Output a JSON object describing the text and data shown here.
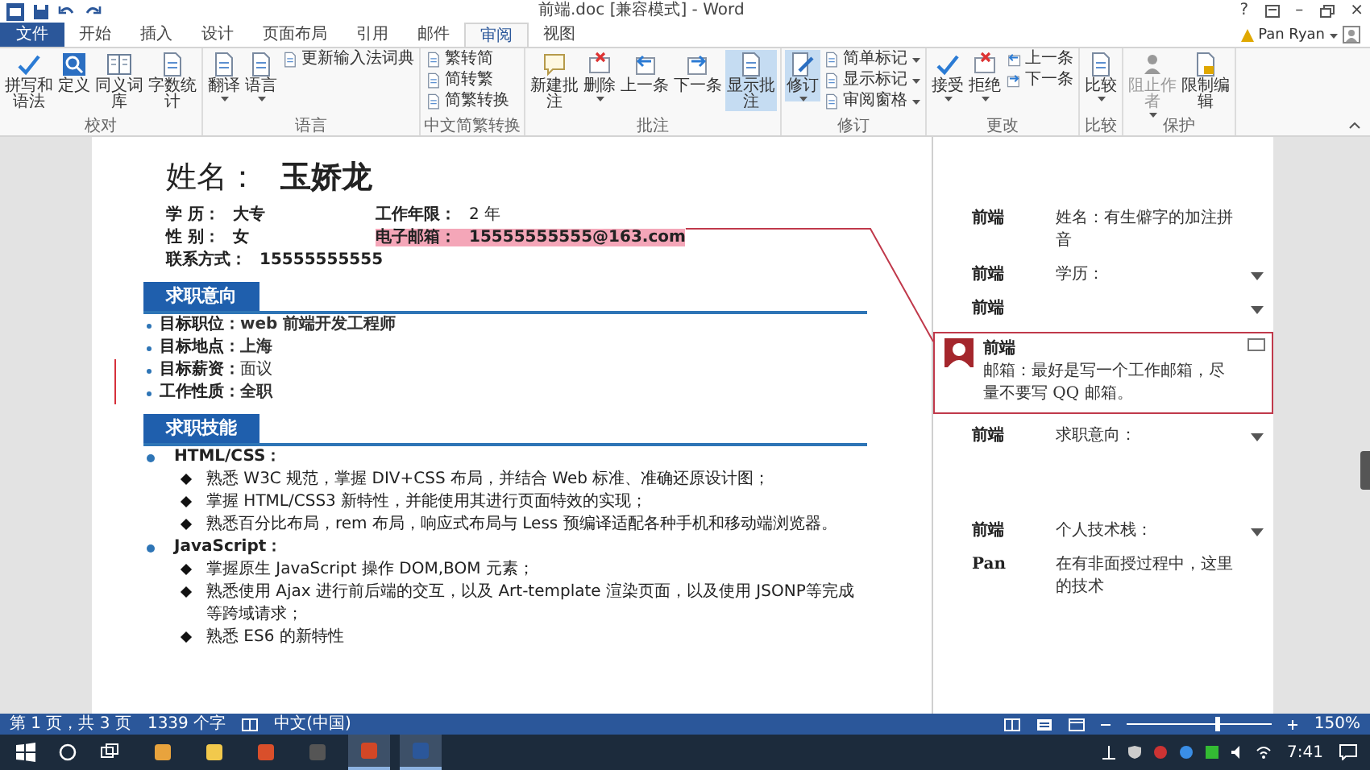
{
  "window": {
    "title": "前端.doc [兼容模式] - Word",
    "help": "?",
    "minimize": "–",
    "close": "×",
    "user": "Pan Ryan"
  },
  "tabs": [
    {
      "label": "文件",
      "kind": "file",
      "selected": false
    },
    {
      "label": "开始",
      "kind": "tab",
      "selected": false
    },
    {
      "label": "插入",
      "kind": "tab",
      "selected": false
    },
    {
      "label": "设计",
      "kind": "tab",
      "selected": false
    },
    {
      "label": "页面布局",
      "kind": "tab",
      "selected": false
    },
    {
      "label": "引用",
      "kind": "tab",
      "selected": false
    },
    {
      "label": "邮件",
      "kind": "tab",
      "selected": false
    },
    {
      "label": "审阅",
      "kind": "tab",
      "selected": true
    },
    {
      "label": "视图",
      "kind": "tab",
      "selected": false
    }
  ],
  "ribbon": [
    {
      "label": "校对",
      "buttons": [
        {
          "label": "拼写和语法",
          "kind": "large"
        },
        {
          "label": "定义",
          "kind": "large"
        },
        {
          "label": "同义词库",
          "kind": "large"
        },
        {
          "label": "字数统计",
          "kind": "large"
        }
      ]
    },
    {
      "label": "语言",
      "buttons": [
        {
          "label": "翻译",
          "kind": "large",
          "dropdown": true
        },
        {
          "label": "语言",
          "kind": "large",
          "dropdown": true
        },
        {
          "label": "更新输入法词典",
          "kind": "small"
        }
      ]
    },
    {
      "label": "中文简繁转换",
      "buttons": [
        {
          "label": "繁转简",
          "kind": "small"
        },
        {
          "label": "简转繁",
          "kind": "small"
        },
        {
          "label": "简繁转换",
          "kind": "small"
        }
      ]
    },
    {
      "label": "批注",
      "buttons": [
        {
          "label": "新建批注",
          "kind": "large"
        },
        {
          "label": "删除",
          "kind": "large",
          "dropdown": true
        },
        {
          "label": "上一条",
          "kind": "large"
        },
        {
          "label": "下一条",
          "kind": "large"
        },
        {
          "label": "显示批注",
          "kind": "large",
          "selected": true
        }
      ]
    },
    {
      "label": "修订",
      "buttons": [
        {
          "label": "修订",
          "kind": "large",
          "dropdown": true,
          "selected": true
        },
        {
          "label": "简单标记",
          "kind": "small",
          "dropdown": true
        },
        {
          "label": "显示标记",
          "kind": "small",
          "dropdown": true
        },
        {
          "label": "审阅窗格",
          "kind": "small",
          "dropdown": true
        }
      ]
    },
    {
      "label": "更改",
      "buttons": [
        {
          "label": "接受",
          "kind": "large",
          "dropdown": true
        },
        {
          "label": "拒绝",
          "kind": "large",
          "dropdown": true
        },
        {
          "label": "上一条",
          "kind": "small"
        },
        {
          "label": "下一条",
          "kind": "small"
        }
      ]
    },
    {
      "label": "比较",
      "buttons": [
        {
          "label": "比较",
          "kind": "large",
          "dropdown": true
        }
      ]
    },
    {
      "label": "保护",
      "buttons": [
        {
          "label": "阻止作者",
          "kind": "large",
          "dropdown": true,
          "disabled": true
        },
        {
          "label": "限制编辑",
          "kind": "large"
        }
      ]
    }
  ],
  "document": {
    "name_label": "姓名：",
    "name": "玉娇龙",
    "info": [
      {
        "label": "学 历：",
        "value": "大专",
        "value_bold": true,
        "commented": false
      },
      {
        "label": "工作年限：",
        "value": "2 年",
        "value_bold": false,
        "commented": false
      },
      {
        "label": "性 别：",
        "value": "女",
        "value_bold": true,
        "commented": false
      },
      {
        "label": "电子邮箱：",
        "value": "15555555555@163.com",
        "value_bold": true,
        "commented": true
      },
      {
        "label": "联系方式：",
        "value": "15555555555",
        "value_bold": true,
        "commented": false
      }
    ],
    "sections": [
      {
        "title": "求职意向",
        "kind": "list",
        "items": [
          {
            "label": "目标职位：",
            "value": "web 前端开发工程师",
            "value_bold": true,
            "changed": false
          },
          {
            "label": "目标地点：",
            "value": "上海",
            "value_bold": true,
            "changed": false
          },
          {
            "label": "目标薪资：",
            "value": "面议",
            "value_bold": false,
            "changed": true
          },
          {
            "label": "工作性质：",
            "value": "全职",
            "value_bold": true,
            "changed": true
          }
        ]
      },
      {
        "title": "求职技能",
        "kind": "outline",
        "items": [
          {
            "text": "HTML/CSS：",
            "children": [
              {
                "text": "熟悉 W3C 规范，掌握 DIV+CSS 布局，并结合 Web 标准、准确还原设计图；"
              },
              {
                "text": "掌握 HTML/CSS3 新特性，并能使用其进行页面特效的实现；"
              },
              {
                "text": "熟悉百分比布局，rem 布局，响应式布局与 Less 预编译适配各种手机和移动端浏览器。"
              }
            ]
          },
          {
            "text": "JavaScript：",
            "children": [
              {
                "text": "掌握原生 JavaScript 操作 DOM,BOM  元素；"
              },
              {
                "text": "熟悉使用 Ajax 进行前后端的交互，以及 Art-template 渲染页面，以及使用 JSONP等完成等跨域请求；"
              },
              {
                "text": "熟悉 ES6 的新特性"
              }
            ]
          }
        ]
      }
    ]
  },
  "comments": [
    {
      "author": "前端",
      "text": "姓名：有生僻字的加注拼音",
      "more": false,
      "selected": false
    },
    {
      "author": "前端",
      "text": "学历：",
      "more": true,
      "selected": false
    },
    {
      "author": "前端",
      "more": true,
      "selected": false
    },
    {
      "author": "前端",
      "text": "邮箱：最好是写一个工作邮箱，尽量不要写 QQ 邮箱。",
      "more": false,
      "selected": true
    },
    {
      "author": "前端",
      "text": "求职意向：",
      "more": true,
      "selected": false
    },
    {
      "author": "前端",
      "text": "个人技术栈：",
      "more": true,
      "selected": false
    },
    {
      "author": "Pan",
      "text": "在有非面授过程中，这里的技术",
      "more": false,
      "selected": false
    }
  ],
  "status_bar": {
    "page": "第 1 页，共 3 页",
    "words": "1339 个字",
    "language": "中文(中国)",
    "zoom": "150%",
    "zoom_level": {
      "level": 0.62
    }
  },
  "taskbar": {
    "apps": [
      {
        "color": "#e8a33d",
        "selected": false
      },
      {
        "color": "#f2c94c",
        "selected": false
      },
      {
        "color": "#d94f2b",
        "selected": false
      },
      {
        "color": "#555555",
        "selected": false
      },
      {
        "color": "#d24726",
        "selected": true
      },
      {
        "color": "#2b579a",
        "selected": true
      }
    ],
    "time": "7:41"
  }
}
